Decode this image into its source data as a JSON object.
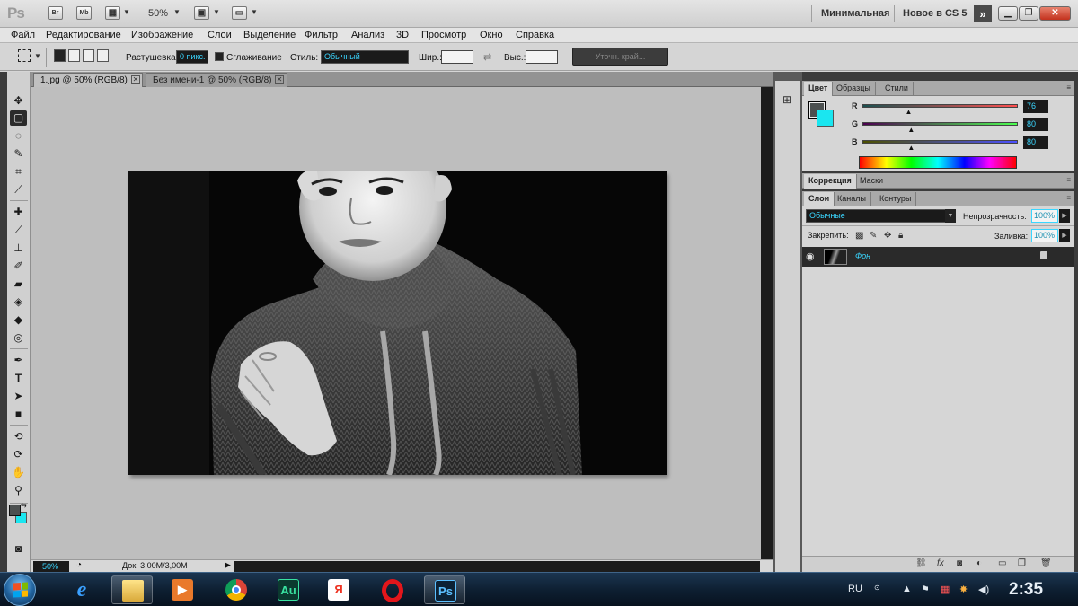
{
  "app": {
    "logo": "Ps",
    "bridge_label": "Br",
    "minibridge_label": "Mb",
    "zoom": "50%",
    "workspace_active": "Минимальная",
    "workspace_new": "Новое в CS 5"
  },
  "menu": [
    "Файл",
    "Редактирование",
    "Изображение",
    "Слои",
    "Выделение",
    "Фильтр",
    "Анализ",
    "3D",
    "Просмотр",
    "Окно",
    "Справка"
  ],
  "options": {
    "feather_label": "Растушевка:",
    "feather_value": "0 пикс.",
    "antialias_label": "Сглаживание",
    "style_label": "Стиль:",
    "style_value": "Обычный",
    "width_label": "Шир.:",
    "height_label": "Выс.:",
    "refine_label": "Уточн. край..."
  },
  "documents": {
    "tabs": [
      {
        "label": "1.jpg @ 50% (RGB/8)",
        "active": true
      },
      {
        "label": "Без имени-1 @ 50% (RGB/8)",
        "active": false
      }
    ],
    "status_zoom": "50%",
    "status_doc": "Док: 3,00M/3,00M"
  },
  "color_panel": {
    "tabs": [
      "Цвет",
      "Образцы",
      "Стили"
    ],
    "channels": [
      {
        "label": "R",
        "value": "76",
        "level": 0.298,
        "color": "#e02020"
      },
      {
        "label": "G",
        "value": "80",
        "level": 0.314,
        "color": "#20c020"
      },
      {
        "label": "B",
        "value": "80",
        "level": 0.314,
        "color": "#2030e0"
      }
    ],
    "foreground": "#4c5050",
    "background": "#1ae6f0"
  },
  "adjust_panel": {
    "tabs": [
      "Коррекция",
      "Маски"
    ]
  },
  "layers_panel": {
    "tabs": [
      "Слои",
      "Каналы",
      "Контуры"
    ],
    "blend_mode": "Обычные",
    "opacity_label": "Непрозрачность:",
    "opacity_value": "100%",
    "lock_label": "Закрепить:",
    "fill_label": "Заливка:",
    "fill_value": "100%",
    "layers": [
      {
        "name": "Фон",
        "visible": true,
        "locked": true
      }
    ]
  },
  "taskbar": {
    "lang": "RU",
    "time": "2:35",
    "apps": [
      "internet-explorer",
      "explorer",
      "media-player",
      "chrome",
      "audition",
      "yandex",
      "opera",
      "photoshop"
    ]
  },
  "colors": {
    "accent_cyan": "#3ad6ff",
    "panel_dark": "#2a2a2a"
  }
}
